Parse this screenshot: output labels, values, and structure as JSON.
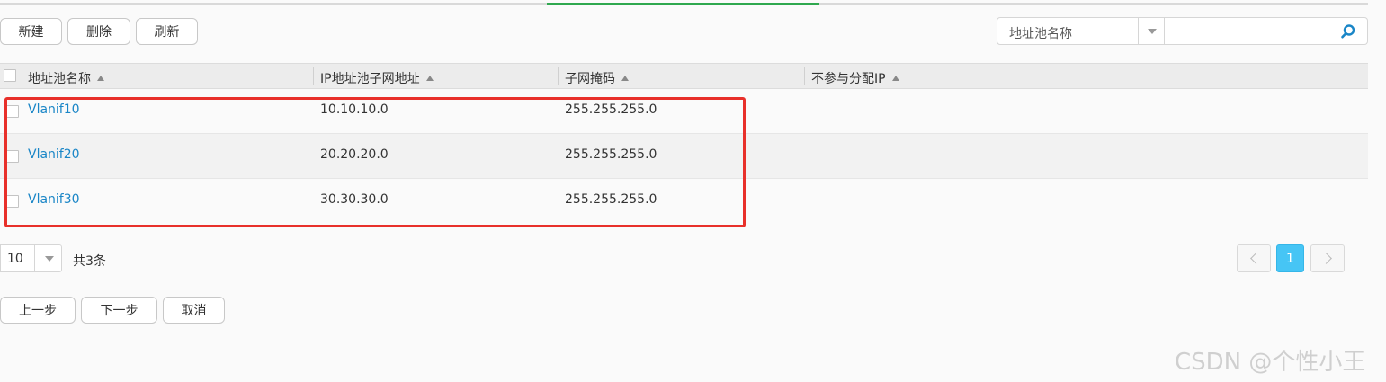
{
  "toolbar": {
    "new_label": "新建",
    "delete_label": "删除",
    "refresh_label": "刷新"
  },
  "search": {
    "field_selected": "地址池名称",
    "placeholder": ""
  },
  "table": {
    "columns": [
      "地址池名称",
      "IP地址池子网地址",
      "子网掩码",
      "不参与分配IP"
    ],
    "rows": [
      {
        "name": "Vlanif10",
        "subnet": "10.10.10.0",
        "mask": "255.255.255.0",
        "excluded": ""
      },
      {
        "name": "Vlanif20",
        "subnet": "20.20.20.0",
        "mask": "255.255.255.0",
        "excluded": ""
      },
      {
        "name": "Vlanif30",
        "subnet": "30.30.30.0",
        "mask": "255.255.255.0",
        "excluded": ""
      }
    ]
  },
  "pagination": {
    "page_size": "10",
    "total_text": "共3条",
    "current_page": "1"
  },
  "wizard": {
    "prev_label": "上一步",
    "next_label": "下一步",
    "cancel_label": "取消"
  },
  "watermark": "CSDN @个性小王",
  "colors": {
    "accent_link": "#1a86c7",
    "highlight_box": "#e8302a",
    "active_page": "#46c5f5",
    "progress": "#2fa84f"
  }
}
